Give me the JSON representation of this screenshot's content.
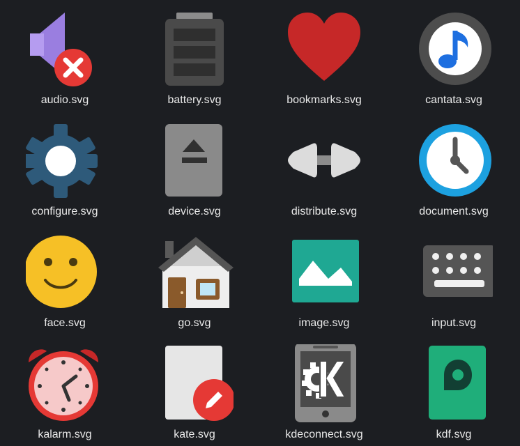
{
  "icons": [
    {
      "label": "audio.svg",
      "icon": "audio-muted-icon"
    },
    {
      "label": "battery.svg",
      "icon": "battery-icon"
    },
    {
      "label": "bookmarks.svg",
      "icon": "heart-icon"
    },
    {
      "label": "cantata.svg",
      "icon": "music-note-icon"
    },
    {
      "label": "configure.svg",
      "icon": "gear-icon"
    },
    {
      "label": "device.svg",
      "icon": "eject-icon"
    },
    {
      "label": "distribute.svg",
      "icon": "distribute-arrows-icon"
    },
    {
      "label": "document.svg",
      "icon": "clock-icon"
    },
    {
      "label": "face.svg",
      "icon": "smiley-icon"
    },
    {
      "label": "go.svg",
      "icon": "house-icon"
    },
    {
      "label": "image.svg",
      "icon": "mountain-image-icon"
    },
    {
      "label": "input.svg",
      "icon": "keyboard-icon"
    },
    {
      "label": "kalarm.svg",
      "icon": "alarm-clock-icon"
    },
    {
      "label": "kate.svg",
      "icon": "kate-pencil-icon"
    },
    {
      "label": "kdeconnect.svg",
      "icon": "kde-phone-icon"
    },
    {
      "label": "kdf.svg",
      "icon": "kdf-disk-icon"
    }
  ],
  "colors": {
    "background": "#1c1e22",
    "label": "#e9e9e9"
  }
}
